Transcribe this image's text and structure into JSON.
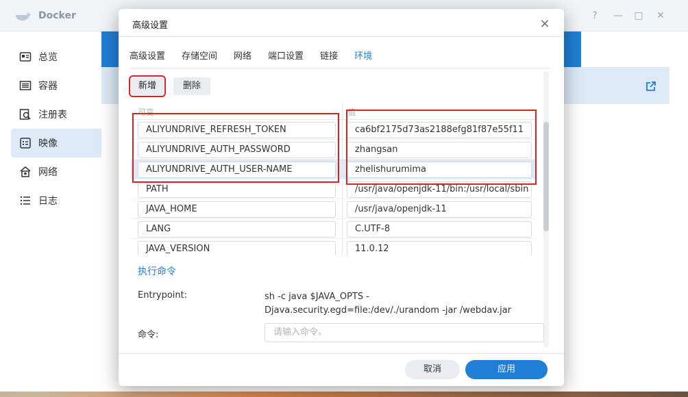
{
  "app": {
    "title": "Docker",
    "window_controls": [
      "?",
      "—",
      "□",
      "✕"
    ]
  },
  "sidebar": {
    "items": [
      {
        "label": "总览",
        "icon": "overview-icon"
      },
      {
        "label": "容器",
        "icon": "container-icon"
      },
      {
        "label": "注册表",
        "icon": "registry-icon"
      },
      {
        "label": "映像",
        "icon": "image-icon",
        "active": true
      },
      {
        "label": "网络",
        "icon": "network-icon"
      },
      {
        "label": "日志",
        "icon": "log-icon"
      }
    ]
  },
  "dialog": {
    "title": "高级设置",
    "close_label": "×",
    "tabs": [
      {
        "label": "高级设置"
      },
      {
        "label": "存储空间"
      },
      {
        "label": "网络"
      },
      {
        "label": "端口设置"
      },
      {
        "label": "链接"
      },
      {
        "label": "环境",
        "active": true
      }
    ],
    "add_label": "新增",
    "delete_label": "删除",
    "table": {
      "col_variable": "可变",
      "col_value": "值",
      "rows": [
        {
          "key": "ALIYUNDRIVE_REFRESH_TOKEN",
          "value": "ca6bf2175d73as2188efg81f87e55f11"
        },
        {
          "key": "ALIYUNDRIVE_AUTH_PASSWORD",
          "value": "zhangsan"
        },
        {
          "key": "ALIYUNDRIVE_AUTH_USER-NAME",
          "value": "zhelishurumima"
        },
        {
          "key": "PATH",
          "value": "/usr/java/openjdk-11/bin:/usr/local/sbin"
        },
        {
          "key": "JAVA_HOME",
          "value": "/usr/java/openjdk-11"
        },
        {
          "key": "LANG",
          "value": "C.UTF-8"
        },
        {
          "key": "JAVA_VERSION",
          "value": "11.0.12"
        }
      ]
    },
    "exec_section_title": "执行命令",
    "entrypoint_label": "Entrypoint:",
    "entrypoint_value": "sh -c java $JAVA_OPTS -Djava.security.egd=file:/dev/./urandom -jar /webdav.jar",
    "command_label": "命令:",
    "command_placeholder": "请输入命令。",
    "cancel_label": "取消",
    "apply_label": "应用"
  },
  "colors": {
    "accent": "#1f7ed6",
    "highlight_box": "#e02020",
    "selection": "#dce9f6"
  }
}
